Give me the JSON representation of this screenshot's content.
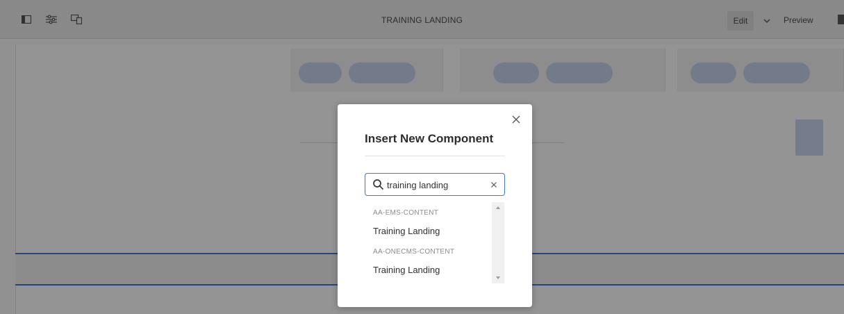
{
  "toolbar": {
    "title": "TRAINING LANDING",
    "edit_label": "Edit",
    "preview_label": "Preview",
    "icons": [
      "side-panel-icon",
      "properties-icon",
      "emulator-icon",
      "chevron-down-icon"
    ]
  },
  "dialog": {
    "title": "Insert New Component",
    "search": {
      "value": "training landing",
      "placeholder": ""
    },
    "groups": [
      {
        "label": "AA-EMS-CONTENT",
        "items": [
          "Training Landing"
        ]
      },
      {
        "label": "AA-ONECMS-CONTENT",
        "items": [
          "Training Landing"
        ]
      }
    ]
  },
  "colors": {
    "accent": "#3e79d6",
    "overlay": "rgba(0,0,0,0.42)"
  }
}
